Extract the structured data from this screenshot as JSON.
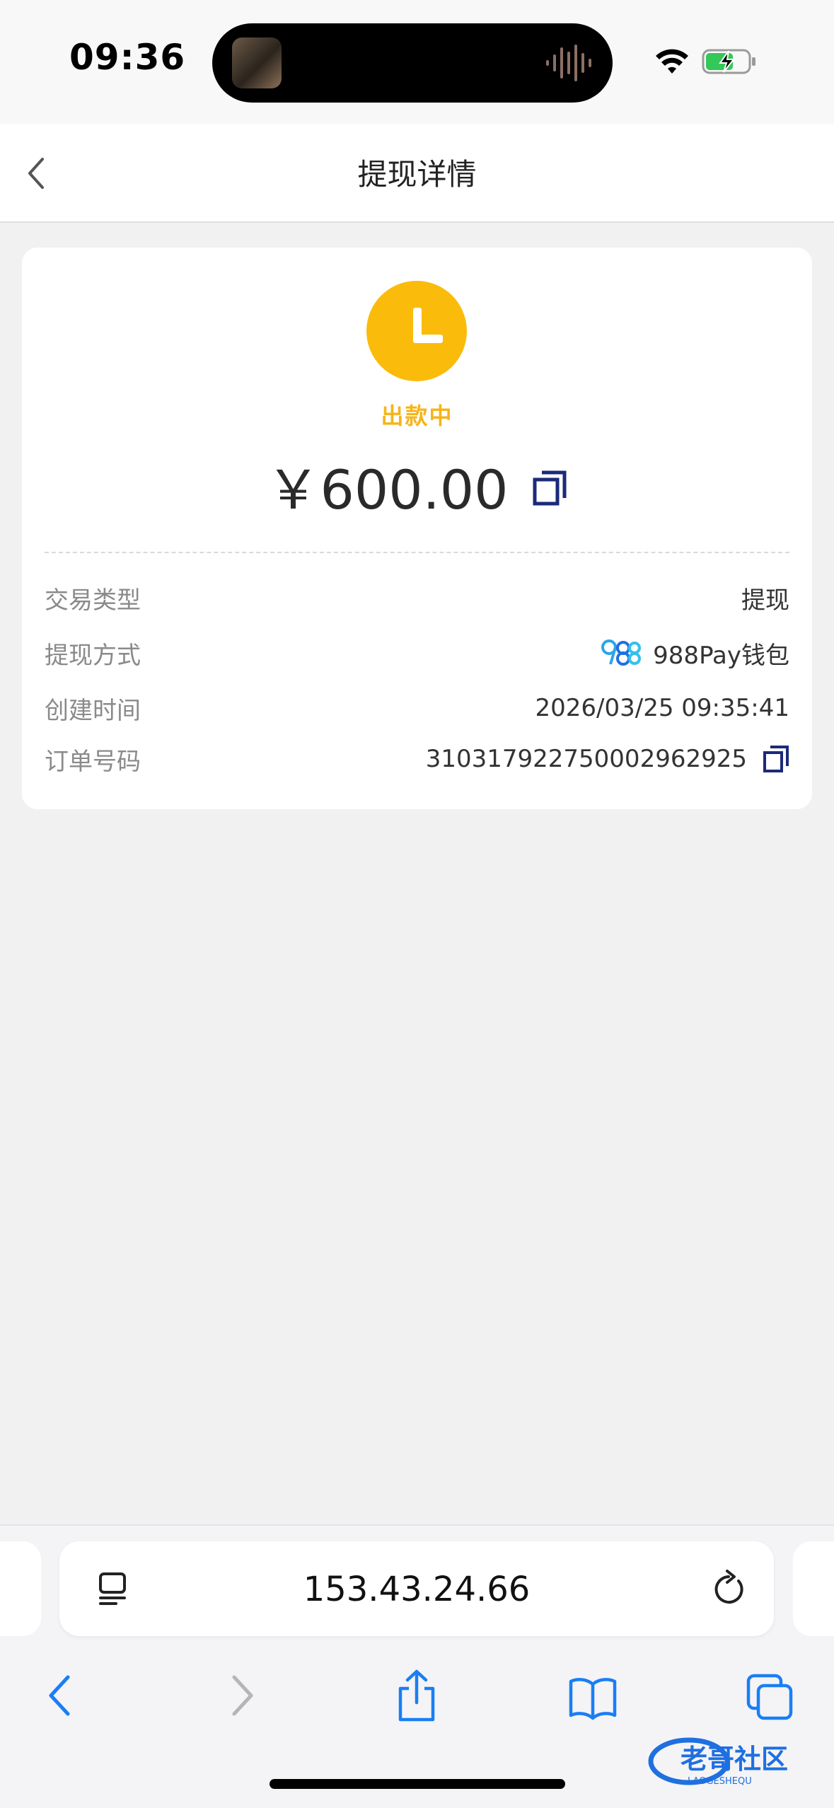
{
  "status_bar": {
    "time": "09:36"
  },
  "header": {
    "title": "提现详情"
  },
  "withdrawal": {
    "status": "出款中",
    "amount": "￥600.00",
    "status_color": "#fbbb0b",
    "rows": [
      {
        "label": "交易类型",
        "value": "提现"
      },
      {
        "label": "提现方式",
        "value": "988Pay钱包"
      },
      {
        "label": "创建时间",
        "value": "2026/03/25 09:35:41"
      },
      {
        "label": "订单号码",
        "value": "310317922750002962925"
      }
    ]
  },
  "browser": {
    "url": "153.43.24.66"
  },
  "watermark": {
    "text": "老哥社区",
    "subtext": "LAOGESHEQU"
  },
  "icons": [
    "back-chevron-icon",
    "clock-icon",
    "copy-icon",
    "988pay-logo-icon",
    "tabs-menu-icon",
    "reload-icon",
    "browser-back-icon",
    "browser-forward-icon",
    "share-icon",
    "bookmarks-icon",
    "tabs-icon"
  ],
  "colors": {
    "accent": "#f6b419",
    "link_blue": "#1a7ef5",
    "copy_icon": "#1b2a7a"
  }
}
